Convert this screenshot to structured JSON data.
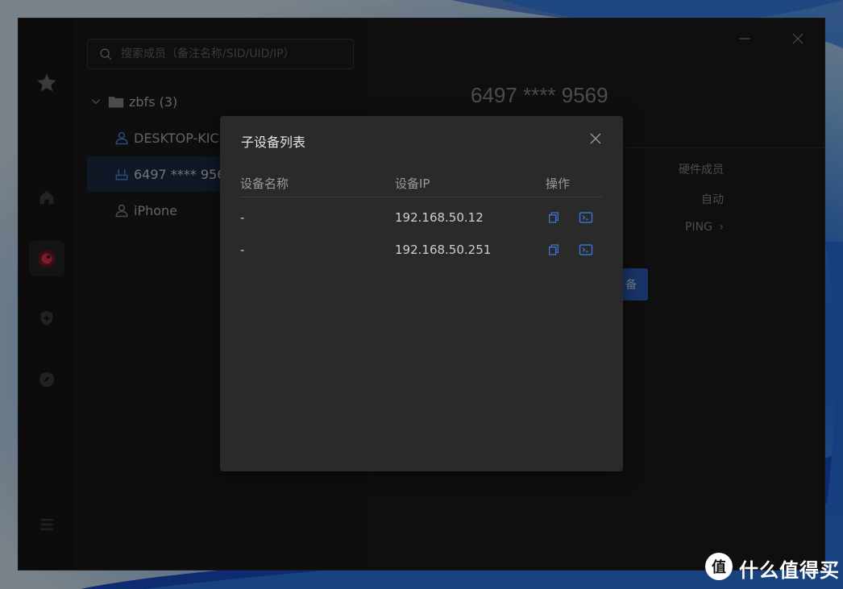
{
  "search": {
    "placeholder": "搜索成员（备注名称/SID/UID/IP）"
  },
  "tree": {
    "group_label": "zbfs (3)",
    "members": [
      "DESKTOP-KIC",
      "6497 **** 956",
      "iPhone"
    ]
  },
  "detail": {
    "title": "6497 **** 9569",
    "rows": [
      "硬件成员",
      "自动",
      "PING"
    ],
    "action_label": "备"
  },
  "icons": {
    "rail": [
      "star-icon",
      "home-icon",
      "network-icon",
      "shield-plus-icon",
      "compass-icon",
      "menu-icon"
    ],
    "window": [
      "minimize-icon",
      "close-icon"
    ],
    "row_ops": [
      "copy-icon",
      "terminal-icon"
    ]
  },
  "modal": {
    "title": "子设备列表",
    "columns": [
      "设备名称",
      "设备IP",
      "操作"
    ],
    "rows": [
      {
        "name": "-",
        "ip": "192.168.50.12"
      },
      {
        "name": "-",
        "ip": "192.168.50.251"
      }
    ]
  },
  "colors": {
    "accent": "#2f5fbf",
    "link_icon": "#3b6fd4",
    "network_active": "#e0344f"
  },
  "watermark": {
    "text": "什么值得买",
    "badge": "值"
  }
}
